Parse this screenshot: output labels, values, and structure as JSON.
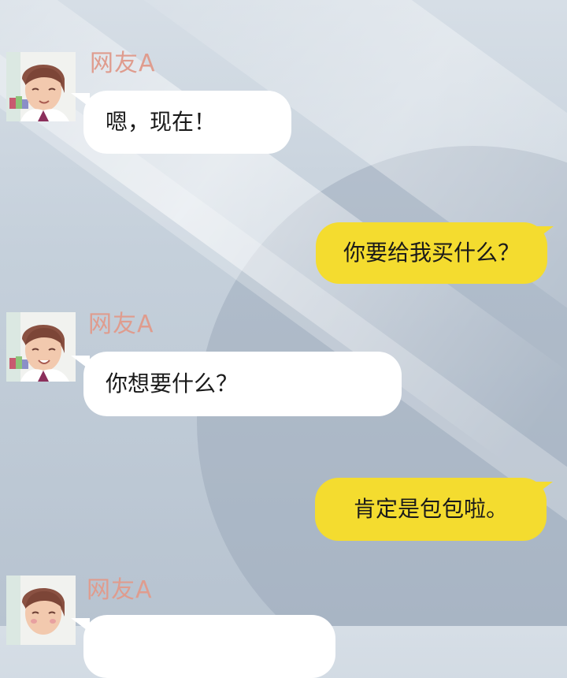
{
  "colors": {
    "sender_name": "#df9c8e",
    "incoming_bubble": "#ffffff",
    "outgoing_bubble": "#f4dc2f",
    "text": "#1a1a1a"
  },
  "messages": [
    {
      "side": "left",
      "sender": "网友A",
      "text": "嗯，现在！",
      "avatar_icon": "avatar-icon"
    },
    {
      "side": "right",
      "text": "你要给我买什么？"
    },
    {
      "side": "left",
      "sender": "网友A",
      "text": "你想要什么？",
      "avatar_icon": "avatar-icon"
    },
    {
      "side": "right",
      "text": "肯定是包包啦。"
    },
    {
      "side": "left",
      "sender": "网友A",
      "text": "",
      "avatar_icon": "avatar-icon"
    }
  ]
}
